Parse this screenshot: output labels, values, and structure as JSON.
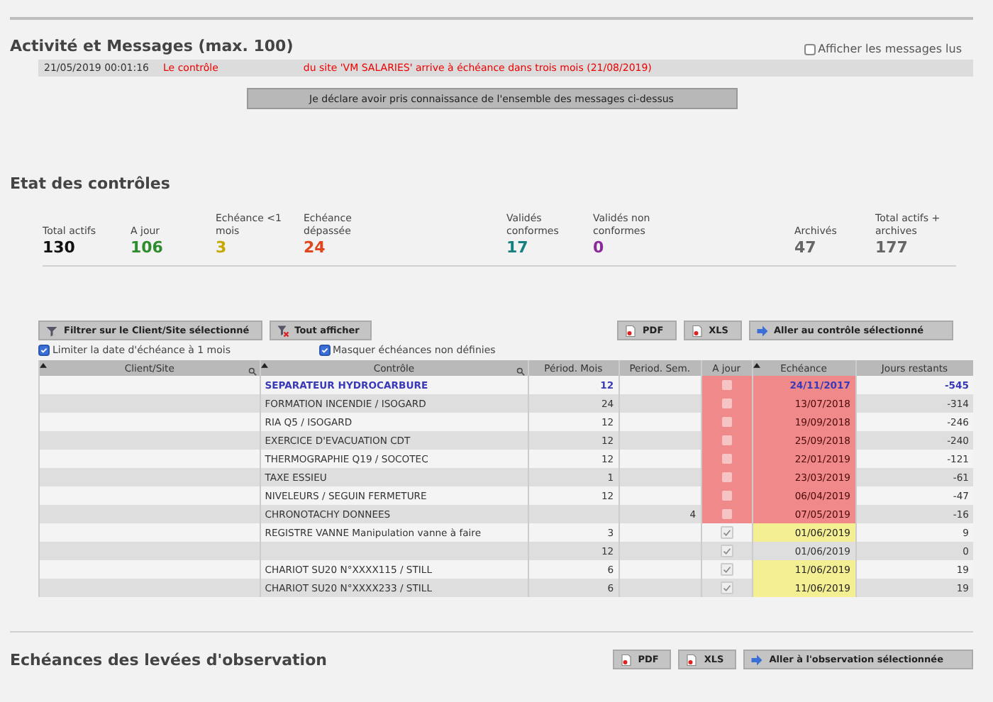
{
  "messages_section": {
    "title": "Activité et Messages (max. 100)",
    "show_read": {
      "label": "Afficher les messages lus",
      "checked": false
    },
    "messages": [
      {
        "timestamp": "21/05/2019 00:01:16",
        "text_1": "Le contrôle",
        "text_2": "du site 'VM SALARIES' arrive à échéance dans trois mois (21/08/2019)"
      }
    ],
    "acknowledge_button": "Je déclare avoir pris connaissance de l'ensemble des messages ci-dessus"
  },
  "status_section": {
    "title": "Etat des contrôles",
    "stats": [
      {
        "label": "Total actifs",
        "value": "130",
        "color": "#111111"
      },
      {
        "label": "A jour",
        "value": "106",
        "color": "#2e8b2e"
      },
      {
        "label": "Echéance <1 mois",
        "value": "3",
        "color": "#c8a800"
      },
      {
        "label": "Echéance dépassée",
        "value": "24",
        "color": "#e0451c"
      },
      {
        "label": "Validés conformes",
        "value": "17",
        "color": "#168080"
      },
      {
        "label": "Validés non conformes",
        "value": "0",
        "color": "#8a2a9a"
      },
      {
        "label": "Archivés",
        "value": "47",
        "color": "#666666"
      },
      {
        "label": "Total actifs + archives",
        "value": "177",
        "color": "#666666"
      }
    ]
  },
  "toolbar": {
    "buttons": [
      {
        "label": "Filtrer sur le Client/Site sélectionné",
        "kind": "filter"
      },
      {
        "label": "Tout afficher",
        "kind": "clear"
      },
      {
        "label": "PDF",
        "kind": "pdf"
      },
      {
        "label": "XLS",
        "kind": "xls"
      },
      {
        "label": "Aller au contrôle sélectionné",
        "kind": "goto"
      }
    ],
    "options": [
      {
        "label": "Limiter la date d'échéance à 1 mois",
        "checked": true
      },
      {
        "label": "Masquer échéances non définies",
        "checked": true
      }
    ]
  },
  "table": {
    "columns": [
      {
        "label": "Client/Site",
        "sortable": true,
        "searchable": true
      },
      {
        "label": "Contrôle",
        "sortable": true,
        "searchable": true
      },
      {
        "label": "Périod. Mois",
        "sortable": false,
        "searchable": false
      },
      {
        "label": "Period. Sem.",
        "sortable": false,
        "searchable": false
      },
      {
        "label": "A jour",
        "sortable": false,
        "searchable": false
      },
      {
        "label": "Echéance",
        "sortable": true,
        "searchable": false
      },
      {
        "label": "Jours restants",
        "sortable": false,
        "searchable": false
      }
    ],
    "rows": [
      {
        "control": "SEPARATEUR HYDROCARBURE",
        "period_months": "12",
        "up_to_date": false,
        "due_date": "24/11/2017",
        "kind": "overdue",
        "days_left": "-545",
        "selected": true
      },
      {
        "control": "FORMATION INCENDIE / ISOGARD",
        "period_months": "24",
        "up_to_date": false,
        "due_date": "13/07/2018",
        "kind": "overdue",
        "days_left": "-314",
        "selected": false
      },
      {
        "control": "RIA Q5 / ISOGARD",
        "period_months": "12",
        "up_to_date": false,
        "due_date": "19/09/2018",
        "kind": "overdue",
        "days_left": "-246",
        "selected": false
      },
      {
        "control": "EXERCICE D'EVACUATION CDT",
        "period_months": "12",
        "up_to_date": false,
        "due_date": "25/09/2018",
        "kind": "overdue",
        "days_left": "-240",
        "selected": false
      },
      {
        "control": "THERMOGRAPHIE Q19 / SOCOTEC",
        "period_months": "12",
        "up_to_date": false,
        "due_date": "22/01/2019",
        "kind": "overdue",
        "days_left": "-121",
        "selected": false
      },
      {
        "control": "TAXE ESSIEU",
        "period_months": "1",
        "up_to_date": false,
        "due_date": "23/03/2019",
        "kind": "overdue",
        "days_left": "-61",
        "selected": false
      },
      {
        "control": "NIVELEURS / SEGUIN FERMETURE",
        "period_months": "12",
        "up_to_date": false,
        "due_date": "06/04/2019",
        "kind": "overdue",
        "days_left": "-47",
        "selected": false
      },
      {
        "control": "CHRONOTACHY DONNEES",
        "period_weeks": "4",
        "up_to_date": false,
        "due_date": "07/05/2019",
        "kind": "overdue",
        "days_left": "-16",
        "selected": false
      },
      {
        "control": "REGISTRE VANNE Manipulation vanne à faire",
        "period_months": "3",
        "up_to_date": true,
        "due_date": "01/06/2019",
        "kind": "soon",
        "days_left": "9",
        "selected": false
      },
      {
        "period_months": "12",
        "up_to_date": true,
        "due_date": "01/06/2019",
        "kind": "ok",
        "days_left": "0",
        "selected": false
      },
      {
        "control": "CHARIOT SU20 N°XXXX115 / STILL",
        "period_months": "6",
        "up_to_date": true,
        "due_date": "11/06/2019",
        "kind": "soon",
        "days_left": "19",
        "selected": false
      },
      {
        "control": "CHARIOT SU20 N°XXXX233 / STILL",
        "period_months": "6",
        "up_to_date": true,
        "due_date": "11/06/2019",
        "kind": "soon",
        "days_left": "19",
        "selected": false
      }
    ]
  },
  "observations_section": {
    "title": "Echéances des levées d'observation",
    "buttons": [
      {
        "label": "PDF",
        "kind": "pdf"
      },
      {
        "label": "XLS",
        "kind": "xls"
      },
      {
        "label": "Aller à l'observation sélectionnée",
        "kind": "goto"
      }
    ]
  }
}
